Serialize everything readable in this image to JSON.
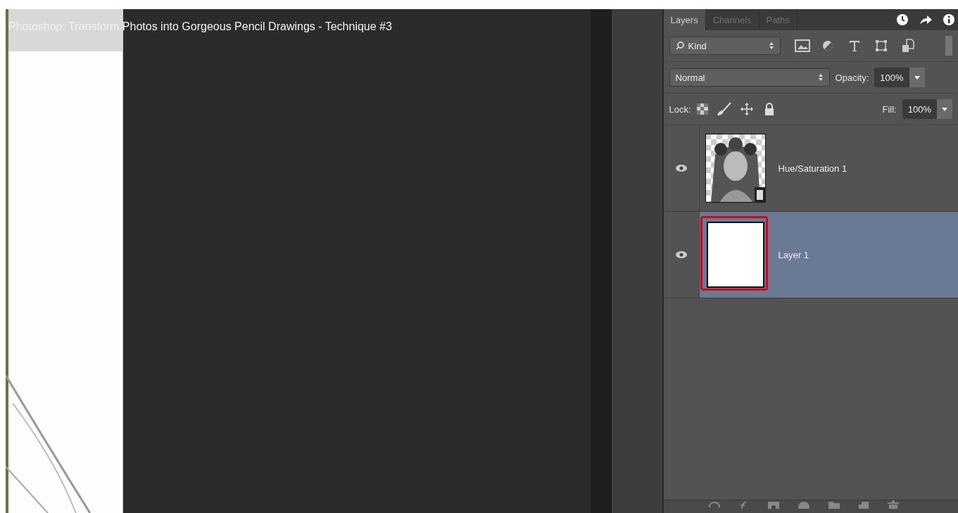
{
  "video_title": "Photoshop: Transform Photos into Gorgeous Pencil Drawings - Technique #3",
  "tabs": [
    {
      "label": "Layers",
      "selected": true
    },
    {
      "label": "Channels",
      "selected": false
    },
    {
      "label": "Paths",
      "selected": false
    }
  ],
  "filter": {
    "label": "Kind"
  },
  "blend_mode": {
    "value": "Normal"
  },
  "opacity": {
    "label": "Opacity:",
    "value": "100%"
  },
  "lock": {
    "label": "Lock:"
  },
  "fill": {
    "label": "Fill:",
    "value": "100%"
  },
  "layers": [
    {
      "name": "Hue/Saturation 1",
      "kind": "picture",
      "selected": false,
      "visible": true,
      "highlighted": false
    },
    {
      "name": "Layer 1",
      "kind": "blank",
      "selected": true,
      "visible": true,
      "highlighted": true
    }
  ]
}
